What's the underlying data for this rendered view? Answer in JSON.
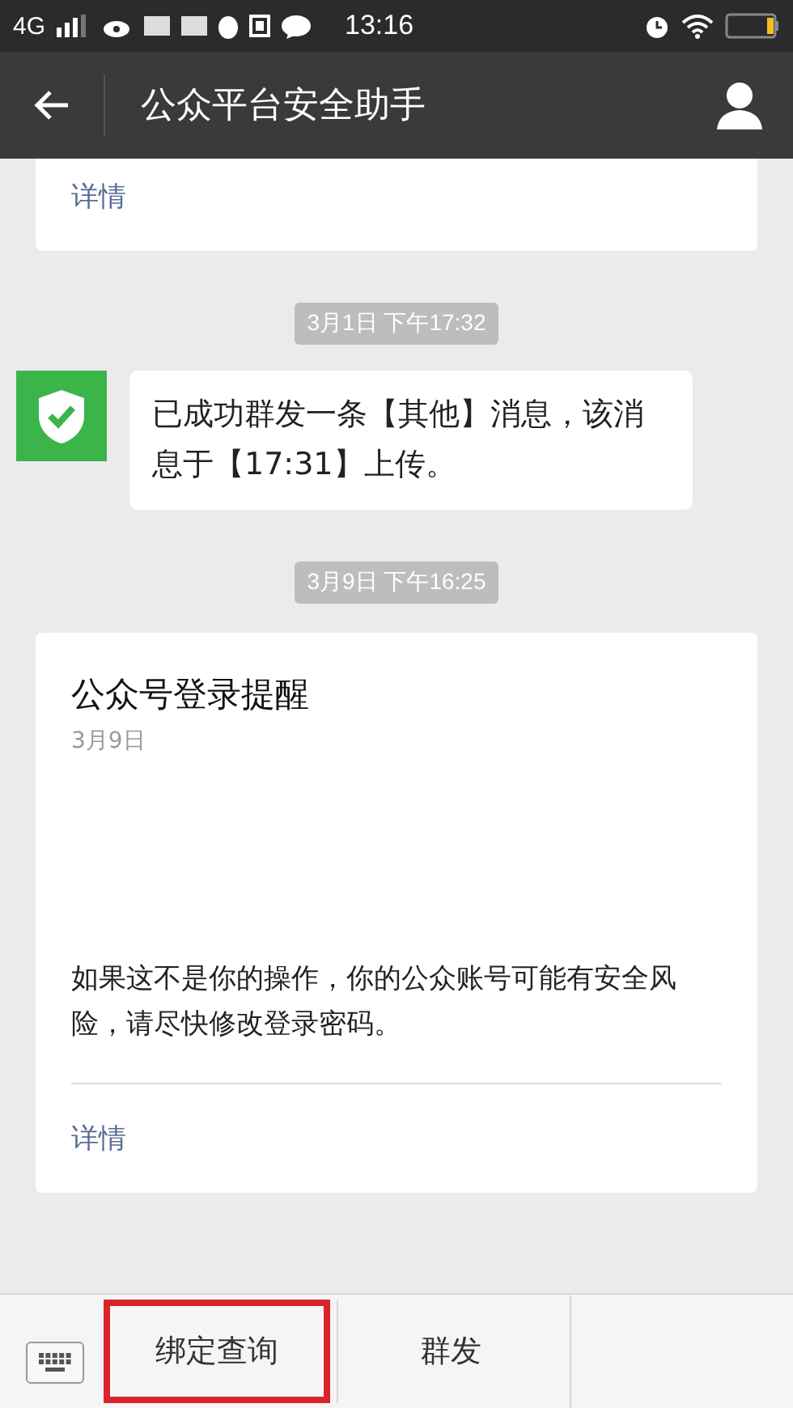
{
  "status_bar": {
    "network": "4G",
    "time": "13:16"
  },
  "nav": {
    "title": "公众平台安全助手"
  },
  "messages": [
    {
      "kind": "card_tail",
      "link": "详情"
    },
    {
      "kind": "time",
      "text": "3月1日 下午17:32"
    },
    {
      "kind": "bubble",
      "text": "已成功群发一条【其他】消息，该消息于【17:31】上传。"
    },
    {
      "kind": "time",
      "text": "3月9日 下午16:25"
    },
    {
      "kind": "card",
      "title": "公众号登录提醒",
      "date": "3月9日",
      "body": "如果这不是你的操作，你的公众账号可能有安全风险，请尽快修改登录密码。",
      "link": "详情"
    }
  ],
  "menu": [
    {
      "label": "绑定查询",
      "highlighted": true
    },
    {
      "label": "群发",
      "highlighted": false
    }
  ]
}
